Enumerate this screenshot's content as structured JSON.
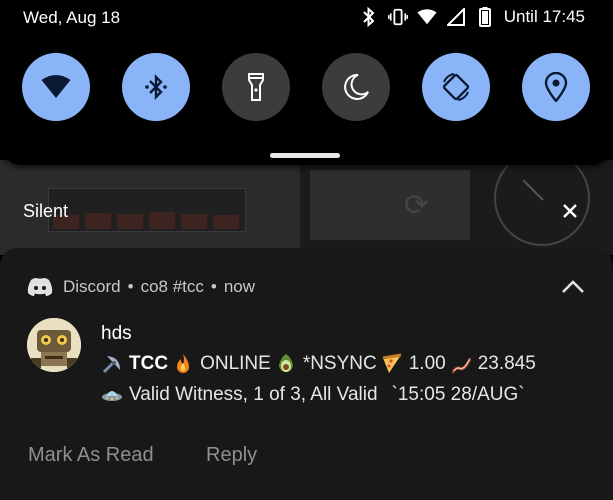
{
  "status_bar": {
    "date": "Wed, Aug 18",
    "until": "Until 17:45",
    "icons": [
      "bluetooth-icon",
      "vibrate-icon",
      "wifi-icon",
      "signal-icon",
      "battery-icon"
    ]
  },
  "quick_settings": {
    "tiles": [
      {
        "name": "wifi",
        "icon": "wifi-icon",
        "active": true
      },
      {
        "name": "bluetooth",
        "icon": "bluetooth-icon",
        "active": true
      },
      {
        "name": "flashlight",
        "icon": "flashlight-icon",
        "active": false
      },
      {
        "name": "do-not-disturb",
        "icon": "moon-icon",
        "active": false
      },
      {
        "name": "auto-rotate",
        "icon": "rotate-icon",
        "active": true
      },
      {
        "name": "location",
        "icon": "location-pin-icon",
        "active": true
      }
    ],
    "accent_color": "#8ab4f8"
  },
  "silent_section": {
    "label": "Silent"
  },
  "notification": {
    "app": "Discord",
    "channel": "co8 #tcc",
    "time": "now",
    "sender": "hds",
    "line1": {
      "ticker": "TCC",
      "status": "ONLINE",
      "sync": "*NSYNC",
      "value1": "1.00",
      "value2": "23.845"
    },
    "line2": {
      "text": "Valid Witness, 1 of 3, All Valid",
      "timestamp": "`15:05 28/AUG`"
    },
    "actions": {
      "mark_read": "Mark As Read",
      "reply": "Reply"
    }
  }
}
